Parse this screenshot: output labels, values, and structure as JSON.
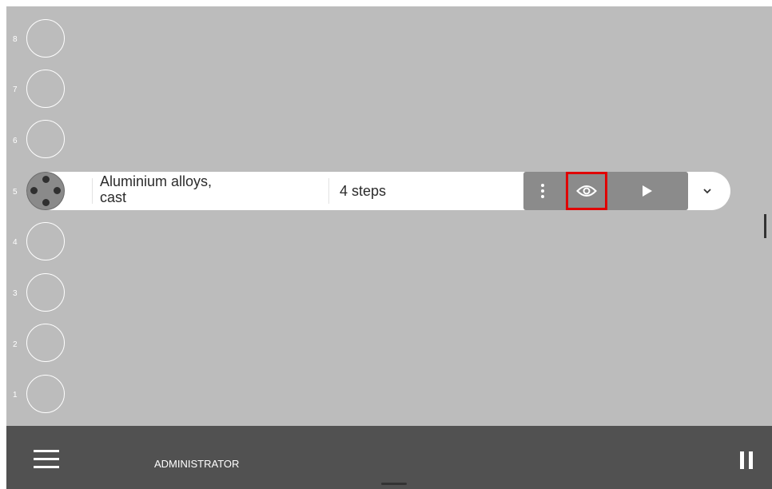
{
  "slots": [
    {
      "number": "8",
      "empty": true
    },
    {
      "number": "7",
      "empty": true
    },
    {
      "number": "6",
      "empty": true
    },
    {
      "number": "5",
      "empty": false
    },
    {
      "number": "4",
      "empty": true
    },
    {
      "number": "3",
      "empty": true
    },
    {
      "number": "2",
      "empty": true
    },
    {
      "number": "1",
      "empty": true
    }
  ],
  "active_slot": {
    "number": "5",
    "name_line1": "Aluminium alloys,",
    "name_line2": "cast",
    "steps": "4 steps"
  },
  "icons": {
    "menu": "vertical-dots-icon",
    "view": "eye-icon",
    "play": "play-icon",
    "expand": "chevron-down-icon",
    "hamburger": "hamburger-menu-icon",
    "pause": "pause-icon"
  },
  "footer": {
    "role": "ADMINISTRATOR"
  },
  "colors": {
    "background": "#bcbcbc",
    "footer": "#515151",
    "button_group": "#8b8b8b",
    "highlight": "#e00000"
  }
}
